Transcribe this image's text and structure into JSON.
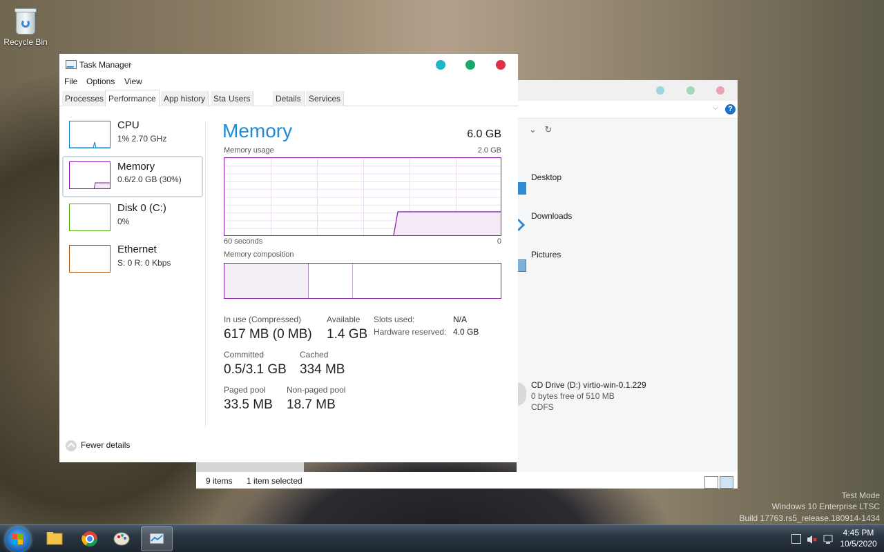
{
  "desktop": {
    "recycle_bin_label": "Recycle Bin"
  },
  "task_manager": {
    "title": "Task Manager",
    "menu": [
      "File",
      "Options",
      "View"
    ],
    "tabs": [
      "Processes",
      "Performance",
      "App history",
      "Startup",
      "Users",
      "Details",
      "Services"
    ],
    "active_tab": "Performance",
    "sidebar": [
      {
        "name": "CPU",
        "value": "1% 2.70 GHz",
        "color": "#117dbb"
      },
      {
        "name": "Memory",
        "value": "0.6/2.0 GB (30%)",
        "color": "#8b12ae",
        "selected": true
      },
      {
        "name": "Disk 0 (C:)",
        "value": "0%",
        "color": "#4da60c"
      },
      {
        "name": "Ethernet",
        "value": "S: 0 R: 0 Kbps",
        "color": "#a74f01"
      }
    ],
    "memory": {
      "heading": "Memory",
      "total": "6.0 GB",
      "usage_label": "Memory usage",
      "usage_max": "2.0 GB",
      "time_left": "60 seconds",
      "time_right": "0",
      "composition_label": "Memory composition",
      "in_use_label": "In use (Compressed)",
      "in_use_value": "617 MB (0 MB)",
      "available_label": "Available",
      "available_value": "1.4 GB",
      "slots_label": "Slots used:",
      "slots_value": "N/A",
      "hw_reserved_label": "Hardware reserved:",
      "hw_reserved_value": "4.0 GB",
      "committed_label": "Committed",
      "committed_value": "0.5/3.1 GB",
      "cached_label": "Cached",
      "cached_value": "334 MB",
      "paged_label": "Paged pool",
      "paged_value": "33.5 MB",
      "nonpaged_label": "Non-paged pool",
      "nonpaged_value": "18.7 MB"
    },
    "fewer_details": "Fewer details",
    "colors": {
      "accent": "#1e8ad6",
      "memory": "#8b12ae",
      "dot_min": "#1fb5c9",
      "dot_max": "#1aa86b",
      "dot_close": "#e0304a"
    }
  },
  "explorer": {
    "folders": [
      "Desktop",
      "Downloads",
      "Pictures"
    ],
    "cd_drive": {
      "name": "CD Drive (D:) virtio-win-0.1.229",
      "free": "0 bytes free of 510 MB",
      "fs": "CDFS"
    },
    "status_items": "9 items",
    "status_selected": "1 item selected"
  },
  "watermark": {
    "line1": "Test Mode",
    "line2": "Windows 10 Enterprise LTSC",
    "line3": "Build 17763.rs5_release.180914-1434"
  },
  "taskbar": {
    "time": "4:45 PM",
    "date": "10/5/2020"
  }
}
